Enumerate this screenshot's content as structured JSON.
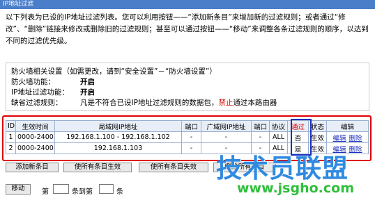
{
  "header": {
    "title": "IP地址过滤"
  },
  "intro": {
    "text": "以下列表为已设的IP地址过滤列表。您可以利用按钮——“添加新条目”来增加新的过滤规则；或者通过“修改”、“删除”链接来修改或删除旧的过滤规则；甚至可以通过按钮——“移动”来调整各条过滤规则的顺序，以达到不同的过滤优先级。"
  },
  "firewall": {
    "heading": "防火墙相关设置（如需更改，请到“安全设置”－“防火墙设置”）",
    "fw_label": "防火墙功能：",
    "fw_value": "开启",
    "ip_label": "IP地址过滤功能：",
    "ip_value": "开启",
    "default_label": "缺省过滤规则：",
    "default_prefix": "凡是不符合已设IP地址过滤规则的数据包，",
    "default_red": "禁止",
    "default_suffix": "通过本路由器"
  },
  "table": {
    "headers": [
      "ID",
      "生效时间",
      "局域网IP地址",
      "端口",
      "广域网IP地址",
      "端口",
      "协议",
      "通过",
      "状态",
      "编辑"
    ],
    "rows": [
      {
        "id": "1",
        "time": "0000-2400",
        "lan_ip": "192.168.1.100 - 192.168.1.102",
        "lan_port": "-",
        "wan_ip": "-",
        "wan_port": "-",
        "protocol": "ALL",
        "pass": "否",
        "status": "生效",
        "edit": "编辑",
        "del": "删除"
      },
      {
        "id": "2",
        "time": "0000-2400",
        "lan_ip": "192.168.1.103",
        "lan_port": "-",
        "wan_ip": "-",
        "wan_port": "-",
        "protocol": "ALL",
        "pass": "是",
        "status": "生效",
        "edit": "编辑",
        "del": "删除"
      }
    ]
  },
  "buttons": {
    "add": "添加新条目",
    "enable_all": "使所有条目生效",
    "disable_all": "使所有条目失效",
    "delete_all": "删除所有条目"
  },
  "move": {
    "button": "移动",
    "label_first": "第",
    "label_to": "条到第",
    "label_end": "条"
  },
  "watermark": {
    "brand": "技术员联盟",
    "url": "www.jsgho.com"
  }
}
